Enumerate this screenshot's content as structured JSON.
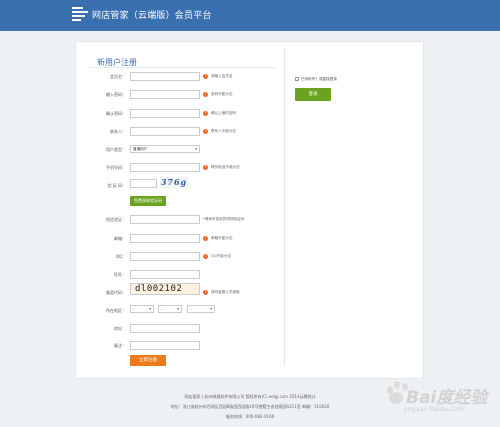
{
  "header": {
    "title": "网店管家（云端版）会员平台"
  },
  "form": {
    "title": "新用户注册",
    "fields": [
      {
        "label": "会员名：",
        "hint": "请输入会员名"
      },
      {
        "label": "输入密码：",
        "hint": "密码不能为空"
      },
      {
        "label": "确认密码：",
        "hint": "确认上面的密码"
      },
      {
        "label": "联系人：",
        "hint": "联系人不能为空"
      },
      {
        "label": "用户类型：",
        "select_value": "普通用户"
      },
      {
        "label": "手机号码：",
        "hint": "联系电话不能为空"
      },
      {
        "label": "验 证 码：",
        "captcha": "376g"
      },
      {
        "label": "短信验证：",
        "hint": "*请填写收到的短信验证码"
      },
      {
        "label": "邮箱：",
        "hint": "邮箱不能为空"
      },
      {
        "label": "QQ：",
        "hint": "QQ不能为空"
      },
      {
        "label": "旺旺："
      },
      {
        "label": "备案代码：",
        "value": "dl002102",
        "hint": "请向客服人员索取"
      },
      {
        "label": "所在地区：",
        "selects": [
          "-",
          "-",
          "-"
        ]
      },
      {
        "label": "地址："
      },
      {
        "label": "备注："
      }
    ],
    "sms_button": "免费获取验证码",
    "submit_button": "立即注册"
  },
  "login": {
    "checkbox_label": "已有帐号？请直接登录",
    "button": "登录"
  },
  "footer": {
    "line1": "网店管家 | 杭州晓通软件有限公司 版权所有(C) wdgj.com 2014云腾统计",
    "line2": "地址：浙江省杭州市西湖区西园8路国西园路10号独墅生态创意园A211室 邮编：310030",
    "line3": "服务热线：400-082-0166"
  },
  "watermark": {
    "text": "Bai度经验",
    "sub": "jingyan.baidu.com"
  },
  "colors": {
    "header_bg": "#3a6fb0",
    "green": "#6aa31f",
    "orange": "#ef7a1a"
  }
}
